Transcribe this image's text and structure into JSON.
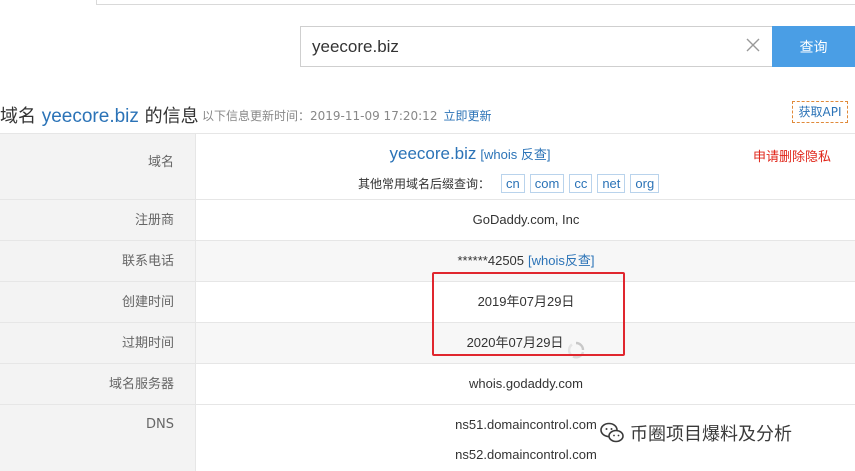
{
  "search": {
    "value": "yeecore.biz",
    "button_label": "查询"
  },
  "header": {
    "title_prefix": "域名",
    "domain": "yeecore.biz",
    "title_suffix": "的信息",
    "update_text": "以下信息更新时间：2019-11-09 17:20:12",
    "refresh_label": "立即更新",
    "api_label": "获取API"
  },
  "rows": {
    "domain": {
      "label": "域名",
      "value": "yeecore.biz",
      "whois_link": "[whois 反查]",
      "suffix_label": "其他常用域名后缀查询：",
      "suffixes": [
        "cn",
        "com",
        "cc",
        "net",
        "org"
      ],
      "privacy_label": "申请删除隐私"
    },
    "registrar": {
      "label": "注册商",
      "value": "GoDaddy.com, Inc"
    },
    "phone": {
      "label": "联系电话",
      "value": "******42505",
      "whois_link": "[whois反查]"
    },
    "created": {
      "label": "创建时间",
      "value": "2019年07月29日"
    },
    "expires": {
      "label": "过期时间",
      "value": "2020年07月29日"
    },
    "nameserver": {
      "label": "域名服务器",
      "value": "whois.godaddy.com"
    },
    "dns": {
      "label": "DNS",
      "values": [
        "ns51.domaincontrol.com",
        "ns52.domaincontrol.com"
      ]
    }
  },
  "watermark": {
    "text": "币圈项目爆料及分析"
  },
  "colors": {
    "accent": "#4a9ee5",
    "link": "#2b73b7",
    "danger": "#e0261a",
    "highlight": "#e0262e"
  },
  "icons": {
    "clear": "close-icon",
    "spinner": "refresh-spinner-icon",
    "watermark": "wechat-icon"
  }
}
